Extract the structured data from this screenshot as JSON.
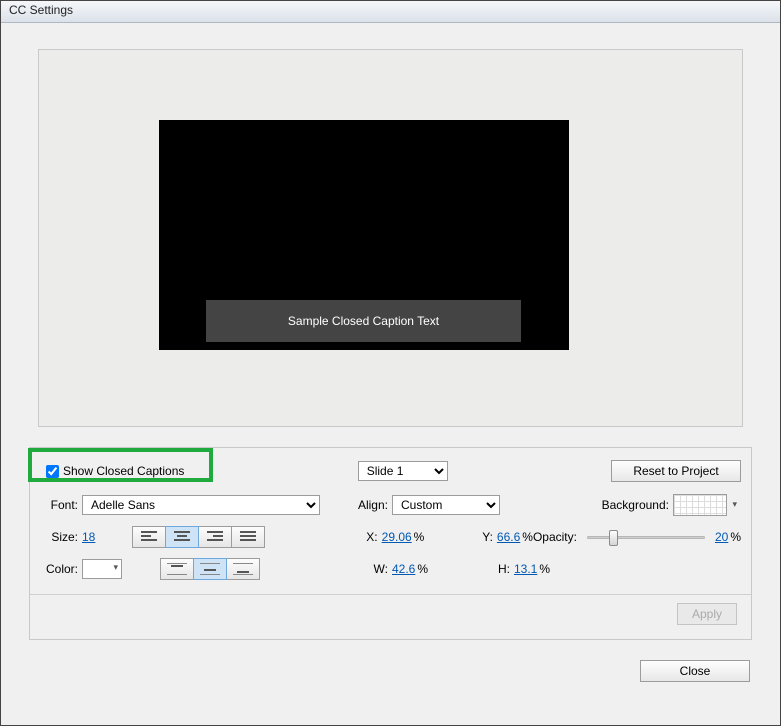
{
  "window": {
    "title": "CC Settings"
  },
  "preview": {
    "sample_text": "Sample Closed Caption Text"
  },
  "controls": {
    "show_cc_label": "Show Closed Captions",
    "show_cc_checked": true,
    "slide_select_value": "Slide 1",
    "reset_label": "Reset to Project",
    "font": {
      "label": "Font:",
      "value": "Adelle Sans"
    },
    "size": {
      "label": "Size:",
      "value": "18"
    },
    "color": {
      "label": "Color:"
    },
    "align": {
      "label": "Align:",
      "value": "Custom"
    },
    "coords": {
      "x_label": "X:",
      "x_value": "29.06",
      "x_unit": "%",
      "y_label": "Y:",
      "y_value": "66.6",
      "y_unit": "%",
      "w_label": "W:",
      "w_value": "42.6",
      "w_unit": "%",
      "h_label": "H:",
      "h_value": "13.1",
      "h_unit": "%"
    },
    "background_label": "Background:",
    "opacity": {
      "label": "Opacity:",
      "value": "20",
      "unit": "%",
      "percent": 20
    },
    "apply_label": "Apply",
    "close_label": "Close"
  }
}
